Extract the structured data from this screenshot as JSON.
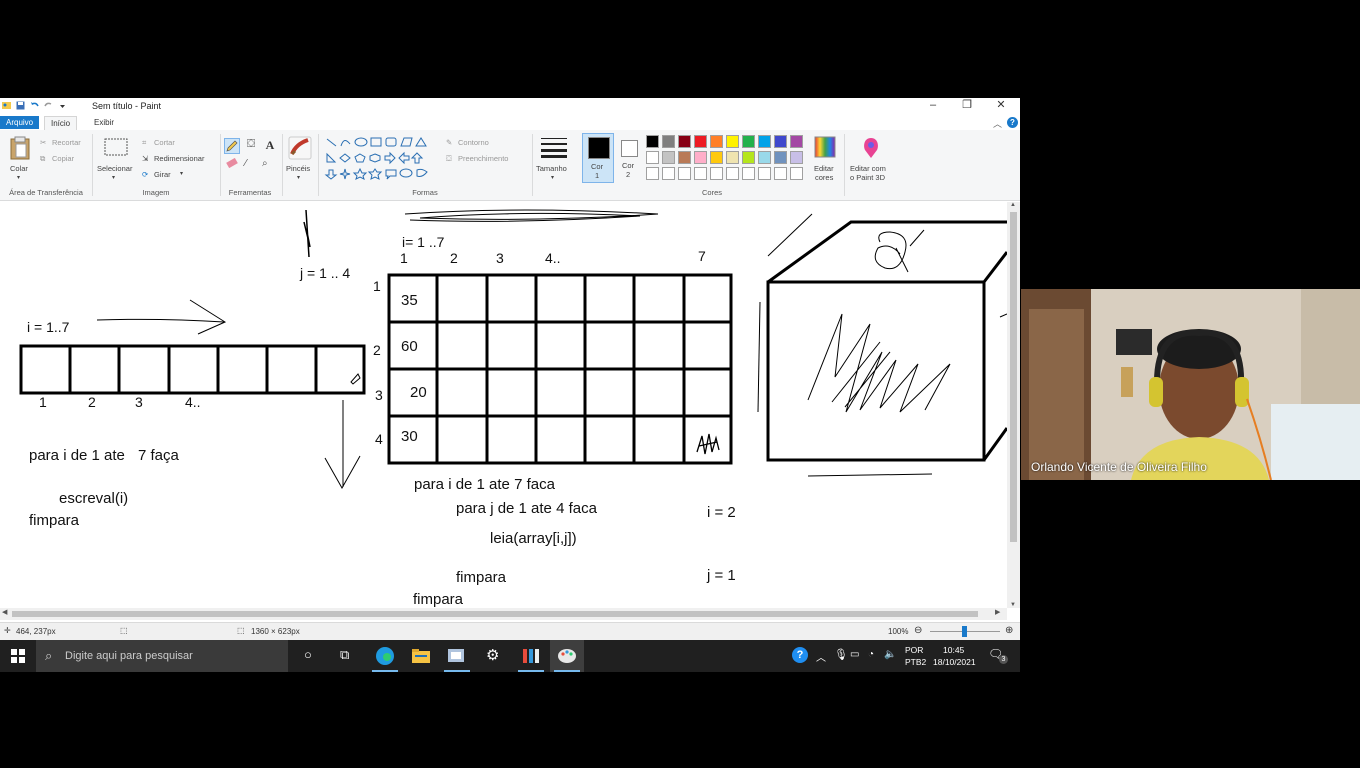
{
  "window": {
    "title": "Sem título - Paint",
    "tabs": [
      "Arquivo",
      "Início",
      "Exibir"
    ]
  },
  "ribbon": {
    "clipboard": {
      "paste": "Colar",
      "cut": "Recortar",
      "copy": "Copiar",
      "group_label": "Área de Transferência"
    },
    "image": {
      "select": "Selecionar",
      "crop": "Cortar",
      "resize": "Redimensionar",
      "rotate": "Girar",
      "group_label": "Imagem"
    },
    "tools": {
      "group_label": "Ferramentas"
    },
    "brushes": {
      "label": "Pincéis"
    },
    "shapes": {
      "outline": "Contorno",
      "fill": "Preenchimento",
      "group_label": "Formas"
    },
    "size": {
      "label": "Tamanho"
    },
    "color1": {
      "label": "Cor\n1",
      "label_a": "Cor",
      "label_b": "1"
    },
    "color2": {
      "label_a": "Cor",
      "label_b": "2"
    },
    "colors": {
      "group_label": "Cores",
      "edit_label_a": "Editar",
      "edit_label_b": "cores",
      "palette_row1": [
        "#000000",
        "#7f7f7f",
        "#880015",
        "#ed1c24",
        "#ff7f27",
        "#fff200",
        "#22b14c",
        "#00a2e8",
        "#3f48cc",
        "#a349a4"
      ],
      "palette_row2": [
        "#ffffff",
        "#c3c3c3",
        "#b97a57",
        "#ffaec9",
        "#ffc90e",
        "#efe4b0",
        "#b5e61d",
        "#99d9ea",
        "#7092be",
        "#c8bfe7"
      ]
    },
    "paint3d": {
      "label_a": "Editar com",
      "label_b": "o Paint 3D"
    }
  },
  "canvas": {
    "left": {
      "i_label": "i = 1..7",
      "indices": [
        "1",
        "2",
        "3",
        "4.."
      ],
      "loop_line1": "para i de 1 ate",
      "loop_line1b": "7 faça",
      "loop_line2": "escreval(i)",
      "loop_line3": "fimpara"
    },
    "middle": {
      "j_label": "j = 1 .. 4",
      "i_label": "i= 1 ..7",
      "col_headers": [
        "1",
        "2",
        "3",
        "4..",
        "7"
      ],
      "row_headers": [
        "1",
        "2",
        "3",
        "4"
      ],
      "first_col": [
        "35",
        "60",
        "20",
        "30"
      ],
      "code1": "para i de 1 ate 7 faca",
      "code2": "para j de 1 ate 4 faca",
      "code3": "leia(array[i,j])",
      "code4": "fimpara",
      "code5": "fimpara",
      "i_eq": "i = 2",
      "j_eq": "j = 1"
    }
  },
  "status": {
    "cursor_pos": "464, 237px",
    "canvas_size": "1360 × 623px",
    "zoom": "100%"
  },
  "taskbar": {
    "search_placeholder": "Digite aqui para pesquisar",
    "lang_a": "POR",
    "lang_b": "PTB2",
    "time": "10:45",
    "date": "18/10/2021",
    "notifications": "3"
  },
  "webcam": {
    "name": "Orlando Vicente de Oliveira Filho"
  }
}
